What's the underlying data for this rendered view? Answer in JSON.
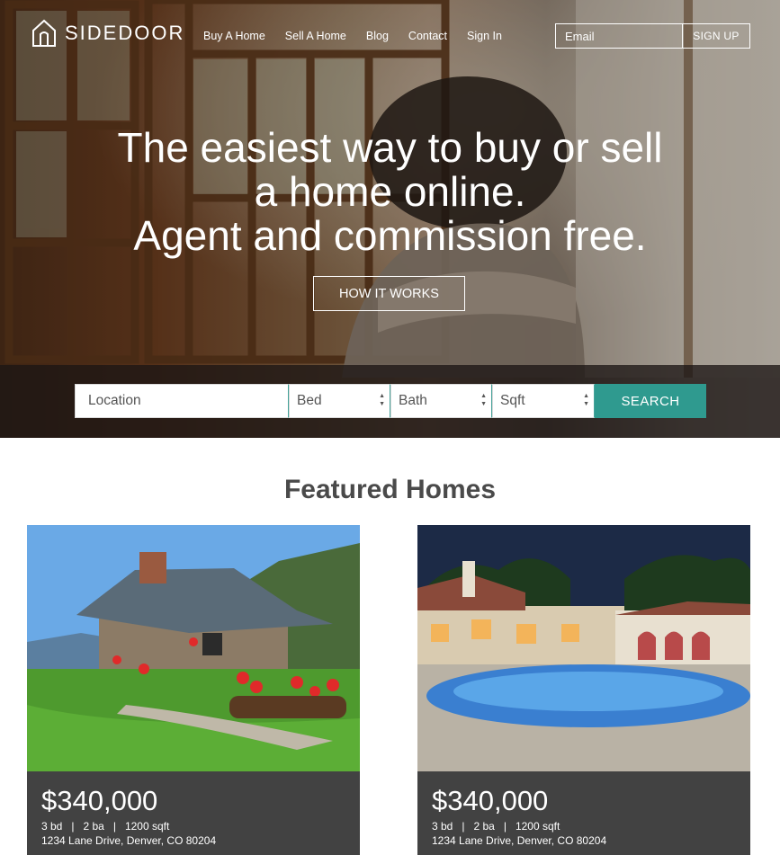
{
  "brand": {
    "name": "SIDEDOOR"
  },
  "nav": {
    "items": [
      "Buy A Home",
      "Sell A Home",
      "Blog",
      "Contact",
      "Sign In"
    ]
  },
  "signup": {
    "email_placeholder": "Email",
    "button_label": "SIGN UP"
  },
  "hero": {
    "headline_line1": "The easiest way to buy or sell",
    "headline_line2": "a home online.",
    "headline_line3": "Agent and commission free.",
    "cta_label": "HOW IT WORKS"
  },
  "search": {
    "location_placeholder": "Location",
    "bed_label": "Bed",
    "bath_label": "Bath",
    "sqft_label": "Sqft",
    "button_label": "SEARCH"
  },
  "featured": {
    "title": "Featured Homes",
    "listings": [
      {
        "price": "$340,000",
        "specs": "3 bd   |   2 ba   |   1200 sqft",
        "address": "1234 Lane Drive, Denver, CO 80204"
      },
      {
        "price": "$340,000",
        "specs": "3 bd   |   2 ba   |   1200 sqft",
        "address": "1234 Lane Drive, Denver, CO 80204"
      }
    ]
  },
  "colors": {
    "accent": "#2f9a8f",
    "card_info_bg": "#424242",
    "title_text": "#4a4a4a"
  }
}
